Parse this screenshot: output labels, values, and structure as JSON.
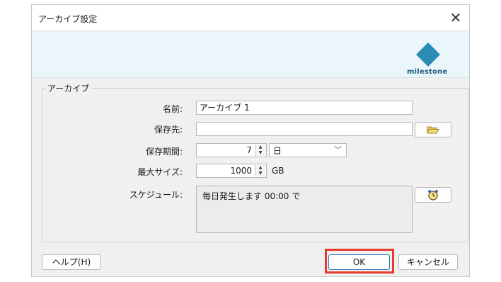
{
  "window": {
    "title": "アーカイブ設定",
    "close_label": "✕"
  },
  "banner": {
    "logo_text": "milestone",
    "accent_color": "#2a8bb5"
  },
  "group": {
    "title": "アーカイブ",
    "name_label": "名前:",
    "name_value": "アーカイブ 1",
    "dest_label": "保存先:",
    "dest_value": "",
    "period_label": "保存期間:",
    "period_value": "7",
    "period_unit": "日",
    "max_size_label": "最大サイズ:",
    "max_size_value": "1000",
    "max_size_unit": "GB",
    "schedule_label": "スケジュール:",
    "schedule_text": "毎日発生します 00:00 で"
  },
  "footer": {
    "help_label": "ヘルプ(H)",
    "ok_label": "OK",
    "cancel_label": "キャンセル",
    "highlight_color": "#e53b2f"
  }
}
